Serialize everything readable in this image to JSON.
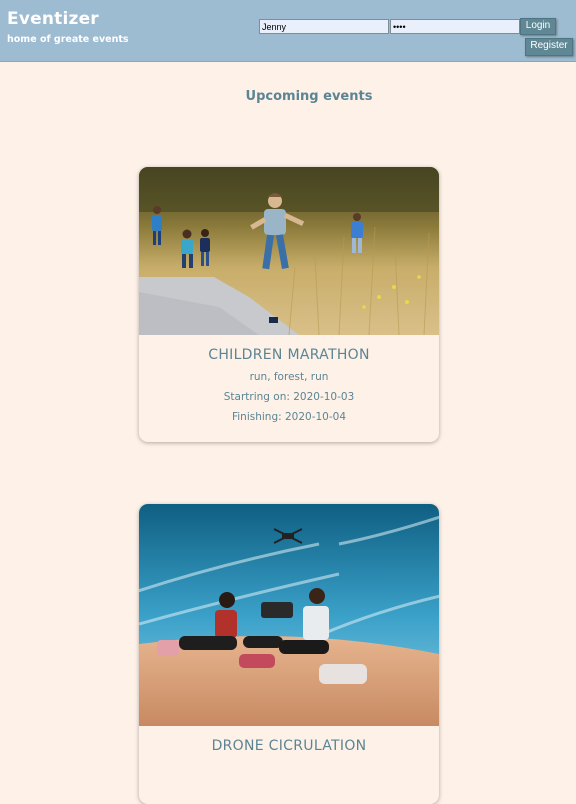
{
  "header": {
    "brand_title": "Eventizer",
    "brand_subtitle": "home of greate events",
    "username_value": "Jenny",
    "password_value": "••••",
    "login_label": "Login",
    "register_label": "Register",
    "background_color": "#9dbbd1"
  },
  "main": {
    "section_title": "Upcoming events",
    "events": [
      {
        "title": "CHILDREN MARATHON",
        "tags": "run, forest, run",
        "start": "Startring on: 2020-10-03",
        "end": "Finishing: 2020-10-04"
      },
      {
        "title": "DRONE CICRULATION"
      }
    ]
  },
  "colors": {
    "page_background": "#fdf1e8",
    "accent_text": "#5b8593",
    "button": "#5f8794"
  }
}
